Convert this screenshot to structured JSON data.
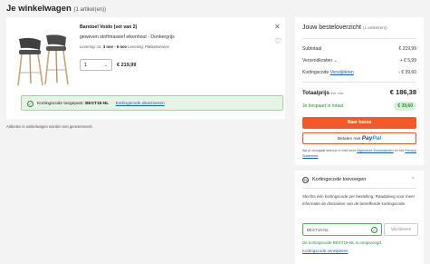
{
  "header": {
    "title": "Je winkelwagen",
    "count": "(1 artikel(en))"
  },
  "cart": {
    "product": {
      "name": "Barstoel Voido (set van 2)",
      "description": "geweven stof/massief eikenhout - Donkergrijs",
      "delivery_prefix": "Levering: ca.",
      "delivery_dates": "3 nov - 6 nov",
      "delivery_suffix": "Levering: Pakketservice",
      "quantity": "1",
      "price": "€ 219,99"
    },
    "coupon_banner": {
      "text": "Kortingscode toegepast:",
      "code": "BEST18-NL",
      "action": "Kortingscode deactiveren"
    },
    "note": "Artikelen in winkelwagen worden niet gereserveerd."
  },
  "summary": {
    "title": "Jouw besteloverzicht",
    "count": "(1 artikel(en))",
    "subtotal_label": "Subtotaal",
    "subtotal_value": "€ 219,99",
    "shipping_label": "Verzendkosten",
    "shipping_value": "+ € 5,99",
    "discount_label": "Kortingscode",
    "discount_link": "Verwijderen",
    "discount_value": "- € 39,60",
    "total_label": "Totaalprijs",
    "total_note": "incl. btw",
    "total_value": "€ 186,38",
    "saved_label": "Je bespaart in totaal",
    "saved_value": "€ 39,60",
    "checkout_button": "Naar kassa",
    "paypal_prefix": "Betalen met",
    "paypal_brand_1": "Pay",
    "paypal_brand_2": "Pal",
    "terms_text_1": "Als je doorgaat stem je in met onze",
    "terms_link_1": "Algemene Voorwaarden",
    "terms_text_2": "en het",
    "terms_link_2": "Privacy Statement"
  },
  "coupon": {
    "header": "Kortingscode toevoegen",
    "description": "Slechts één kortingscode per bestelling. Raadpleeg voor meer informatie de disclaimer van de betreffende kortingscode.",
    "input_value": "BEST18-NL",
    "apply_button": "Verzilveren",
    "success": "De kortingscode BEST18-NL is toegevoegd.",
    "remove_link": "Kortingscode verwijderen"
  },
  "colors": {
    "accent": "#f05a28",
    "success": "#2e8b3a",
    "link": "#1a5fa0"
  }
}
